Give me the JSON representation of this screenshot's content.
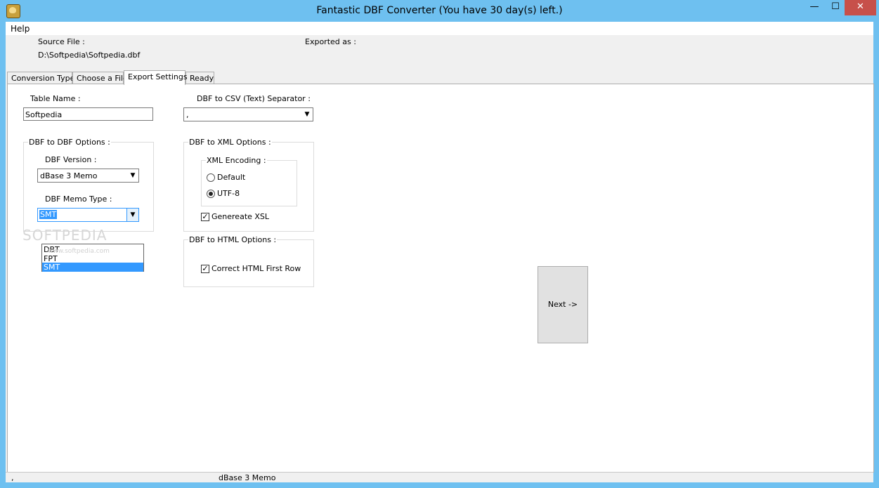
{
  "window": {
    "title": "Fantastic DBF Converter  (You have 30 day(s) left.)",
    "min_glyph": "—",
    "max_glyph": "☐",
    "close_glyph": "✕"
  },
  "menu": {
    "help": "Help"
  },
  "header": {
    "source_label": "Source File :",
    "source_path": "D:\\Softpedia\\Softpedia.dbf",
    "exported_label": "Exported as :"
  },
  "tabs": [
    "Conversion Type",
    "Choose a File",
    "Export Settings",
    "Ready"
  ],
  "export": {
    "table_name_label": "Table Name :",
    "table_name_value": "Softpedia",
    "csv_sep_label": "DBF to CSV (Text) Separator :",
    "csv_sep_value": ",",
    "dbf_options_title": "DBF to DBF Options :",
    "dbf_version_label": "DBF Version :",
    "dbf_version_value": "dBase 3 Memo",
    "memo_type_label": "DBF Memo Type :",
    "memo_type_value": "SMT",
    "memo_options": [
      "DBT",
      "FPT",
      "SMT"
    ],
    "xml_options_title": "DBF to XML Options :",
    "xml_encoding_title": "XML Encoding :",
    "enc_default": "Default",
    "enc_utf8": "UTF-8",
    "generate_xsl": "Genereate XSL",
    "html_options_title": "DBF to HTML Options :",
    "correct_html": "Correct HTML First Row"
  },
  "next_button": "Next ->",
  "status": {
    "left": ",",
    "middle": "dBase 3 Memo"
  },
  "watermark": {
    "main": "SOFTPEDIA",
    "sub": "www.softpedia.com"
  }
}
